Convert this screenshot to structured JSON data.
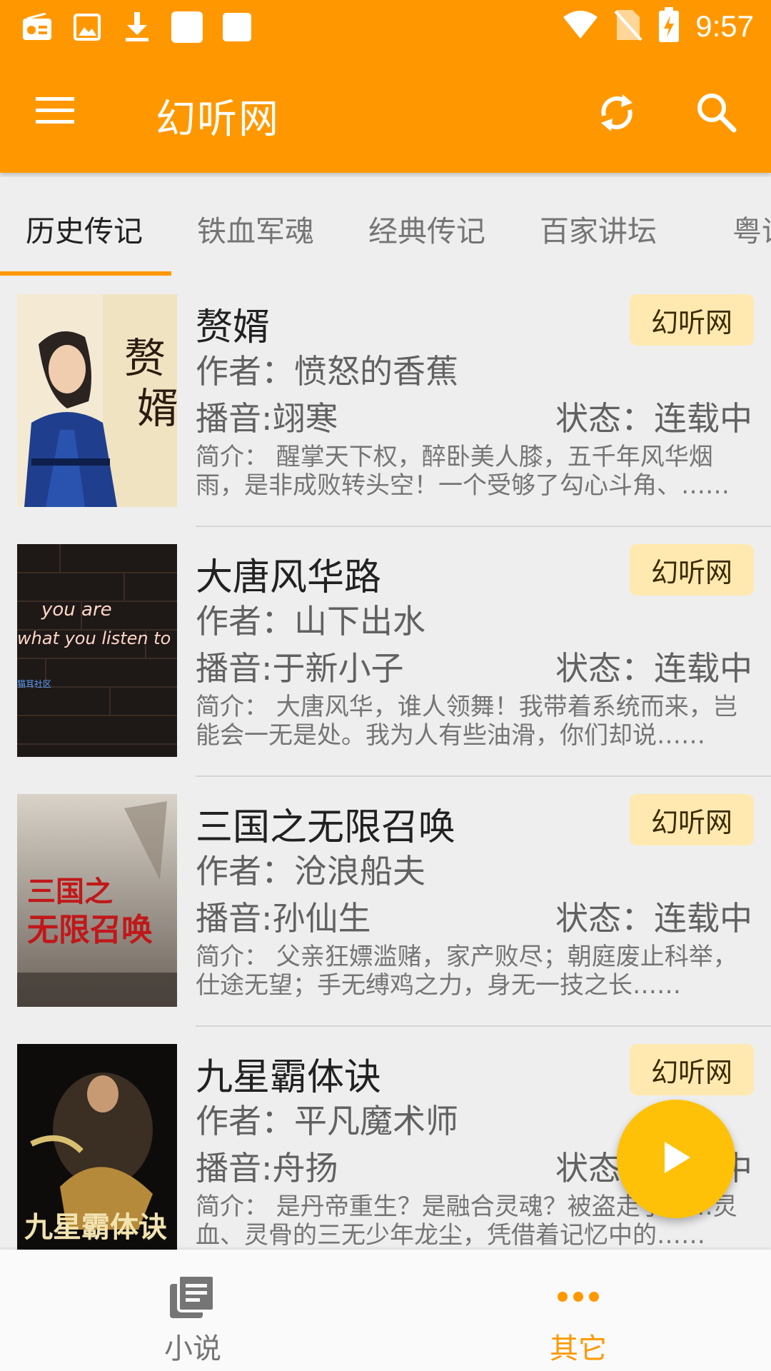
{
  "status_bar": {
    "time": "9:57",
    "left_icons": [
      "radio-icon",
      "image-icon",
      "download-icon",
      "square-icon",
      "square-icon"
    ],
    "right_icons": [
      "wifi-icon",
      "no-sim-icon",
      "battery-charging-icon"
    ]
  },
  "toolbar": {
    "title": "幻听网",
    "menu_icon": "menu-icon",
    "refresh_icon": "refresh-icon",
    "search_icon": "search-icon"
  },
  "tabs": {
    "items": [
      "历史传记",
      "铁血军魂",
      "经典传记",
      "百家讲坛",
      "粤语"
    ],
    "active": "历史传记"
  },
  "books": [
    {
      "title": "赘婿",
      "badge": "幻听网",
      "author": "作者：愤怒的香蕉",
      "narrator": "播音:翊寒",
      "status": "状态：连载中",
      "intro": "简介： 醒掌天下权，醉卧美人膝，五千年风华烟雨，是非成败转头空！一个受够了勾心斗角、……"
    },
    {
      "title": "大唐风华路",
      "badge": "幻听网",
      "author": "作者：山下出水",
      "narrator": "播音:于新小子",
      "status": "状态：连载中",
      "intro": "简介： 大唐风华，谁人领舞！我带着系统而来，岂能会一无是处。我为人有些油滑，你们却说……",
      "cover_text_line1": "you are",
      "cover_text_line2": "what you listen to",
      "cover_watermark": "猫耳社区"
    },
    {
      "title": "三国之无限召唤",
      "badge": "幻听网",
      "author": "作者：沧浪船夫",
      "narrator": "播音:孙仙生",
      "status": "状态：连载中",
      "intro": "简介： 父亲狂嫖滥赌，家产败尽；朝庭废止科举，仕途无望；手无缚鸡之力，身无一技之长……"
    },
    {
      "title": "九星霸体诀",
      "badge": "幻听网",
      "author": "作者：平凡魔术师",
      "narrator": "播音:舟扬",
      "status": "状态：连载中",
      "intro": "简介： 是丹帝重生？是融合灵魂？被盗走了……灵血、灵骨的三无少年龙尘，凭借着记忆中的……"
    }
  ],
  "bottom_nav": {
    "items": [
      {
        "label": "小说",
        "icon": "books-icon",
        "active": false
      },
      {
        "label": "其它",
        "icon": "more-dots-icon",
        "active": true
      }
    ]
  },
  "fab": {
    "icon": "play-icon"
  },
  "colors": {
    "primary": "#ff9800",
    "fab": "#ffc107",
    "badge_bg": "#ffe9b0",
    "background": "#eeeeee"
  }
}
